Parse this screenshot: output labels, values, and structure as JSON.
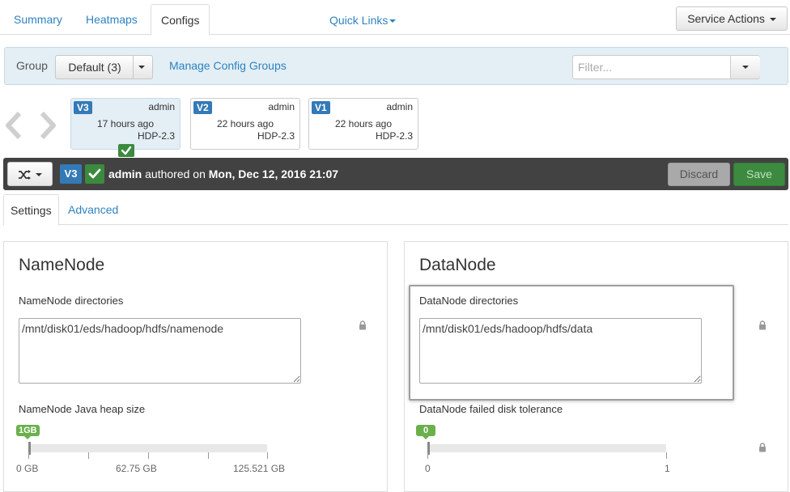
{
  "top_tabs": {
    "summary": "Summary",
    "heatmaps": "Heatmaps",
    "configs": "Configs"
  },
  "quick_links": "Quick Links",
  "service_actions": "Service Actions",
  "group_bar": {
    "label": "Group",
    "selected": "Default (3)",
    "manage_link": "Manage Config Groups",
    "filter_placeholder": "Filter..."
  },
  "versions": [
    {
      "badge": "V3",
      "author": "admin",
      "time": "17 hours ago",
      "stack": "HDP-2.3",
      "current": true
    },
    {
      "badge": "V2",
      "author": "admin",
      "time": "22 hours ago",
      "stack": "HDP-2.3",
      "current": false
    },
    {
      "badge": "V1",
      "author": "admin",
      "time": "22 hours ago",
      "stack": "HDP-2.3",
      "current": false
    }
  ],
  "toolbar": {
    "badge": "V3",
    "author": "admin",
    "authored_on": "authored on",
    "date": "Mon, Dec 12, 2016 21:07",
    "discard": "Discard",
    "save": "Save"
  },
  "sub_tabs": {
    "settings": "Settings",
    "advanced": "Advanced"
  },
  "namenode": {
    "title": "NameNode",
    "dirs_label": "NameNode directories",
    "dirs_value": "/mnt/disk01/eds/hadoop/hdfs/namenode",
    "heap_label": "NameNode Java heap size",
    "heap_value": "1GB",
    "heap_fraction": 0.008,
    "ticks": [
      "0 GB",
      "62.75 GB",
      "125.521 GB"
    ]
  },
  "datanode": {
    "title": "DataNode",
    "dirs_label": "DataNode directories",
    "dirs_value": "/mnt/disk01/eds/hadoop/hdfs/data",
    "tolerance_label": "DataNode failed disk tolerance",
    "tolerance_value": "0",
    "tolerance_fraction": 0,
    "ticks": [
      "0",
      "1"
    ]
  },
  "colors": {
    "link": "#2e83c0",
    "badge_blue": "#337ab7",
    "success_green": "#3c8a3f",
    "slider_green": "#6ab04c",
    "toolbar_dark": "#424242",
    "group_bar_bg": "#e3eef5"
  },
  "icons": [
    "chevron-left-icon",
    "chevron-right-icon",
    "check-icon",
    "shuffle-icon",
    "lock-icon",
    "caret-down-icon"
  ]
}
